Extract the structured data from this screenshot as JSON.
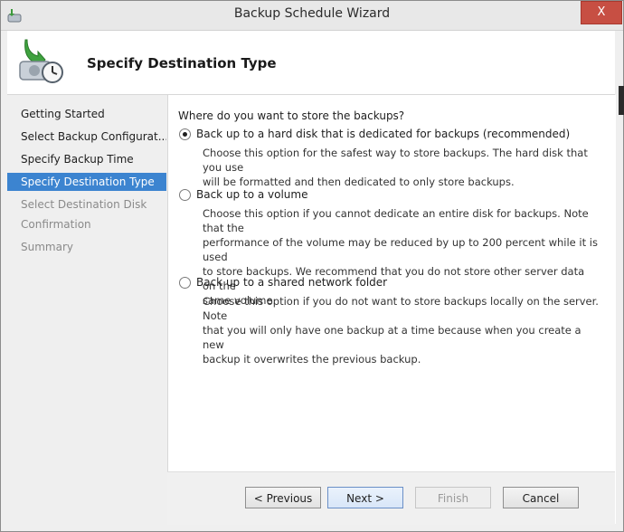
{
  "window": {
    "title": "Backup Schedule Wizard",
    "close_label": "X"
  },
  "header": {
    "title": "Specify Destination Type",
    "icon": "backup-clock-icon"
  },
  "nav": {
    "items": [
      {
        "label": "Getting Started",
        "state": "done"
      },
      {
        "label": "Select Backup Configurat...",
        "state": "done"
      },
      {
        "label": "Specify Backup Time",
        "state": "done"
      },
      {
        "label": "Specify Destination Type",
        "state": "active"
      },
      {
        "label": "Select Destination Disk",
        "state": "disabled"
      },
      {
        "label": "Confirmation",
        "state": "disabled"
      },
      {
        "label": "Summary",
        "state": "disabled"
      }
    ]
  },
  "content": {
    "question": "Where do you want to store the backups?",
    "options": [
      {
        "label": "Back up to a hard disk that is dedicated for backups (recommended)",
        "checked": true,
        "description_lines": [
          "Choose this option for the safest way to store backups. The hard disk that you use",
          "will be formatted and then dedicated to only store backups."
        ]
      },
      {
        "label": "Back up to a volume",
        "checked": false,
        "description_lines": [
          "Choose this option if you cannot dedicate an entire disk for backups. Note that the",
          "performance of the volume may be reduced by up to 200 percent while it is used",
          "to store backups. We recommend that you do not store other server data on the",
          "same volume."
        ]
      },
      {
        "label": "Back up to a shared network folder",
        "checked": false,
        "description_lines": [
          "Choose this option if you do not want to store backups locally on the server. Note",
          "that you will only have one backup at a time because when you create a new",
          "backup it overwrites the previous backup."
        ]
      }
    ]
  },
  "footer": {
    "previous_label": "< Previous",
    "next_label": "Next >",
    "finish_label": "Finish",
    "cancel_label": "Cancel"
  },
  "colors": {
    "selection": "#3c84d0",
    "close_button": "#c74f43"
  }
}
